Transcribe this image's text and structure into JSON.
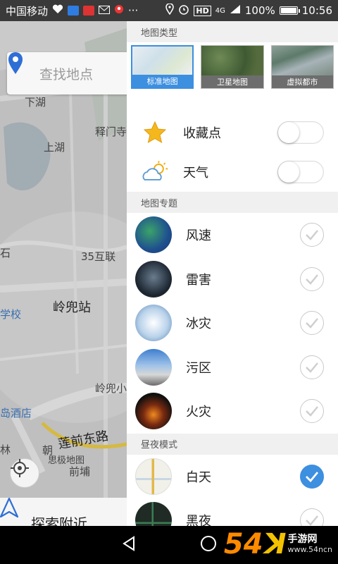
{
  "status_bar": {
    "carrier": "中国移动",
    "network": "4G",
    "battery": "100%",
    "time": "10:56"
  },
  "map": {
    "search_placeholder": "查找地点",
    "labels": [
      "下湖",
      "上湖",
      "释门寺",
      "35互联",
      "岭兜站",
      "岭兜小",
      "学校",
      "岛酒店",
      "林",
      "莲前东路",
      "思极地图",
      "前埔",
      "朝",
      "石"
    ],
    "nearby_label": "探索附近"
  },
  "drawer": {
    "map_type": {
      "header": "地图类型",
      "options": [
        {
          "label": "标准地图",
          "selected": true
        },
        {
          "label": "卫星地图",
          "selected": false
        },
        {
          "label": "虚拟都市",
          "selected": false
        }
      ]
    },
    "toggles": [
      {
        "label": "收藏点",
        "icon": "star-icon",
        "on": false
      },
      {
        "label": "天气",
        "icon": "weather-icon",
        "on": false
      }
    ],
    "topics": {
      "header": "地图专题",
      "items": [
        {
          "label": "风速",
          "checked": false
        },
        {
          "label": "雷害",
          "checked": false
        },
        {
          "label": "冰灾",
          "checked": false
        },
        {
          "label": "污区",
          "checked": false
        },
        {
          "label": "火灾",
          "checked": false
        }
      ]
    },
    "day_night": {
      "header": "昼夜模式",
      "items": [
        {
          "label": "白天",
          "checked": true
        },
        {
          "label": "黑夜",
          "checked": false
        }
      ]
    }
  },
  "watermark": {
    "number": "54",
    "glyph": "ꓘ",
    "title": "手游网",
    "domain": "www.54ncn"
  },
  "colors": {
    "accent": "#3d8fe0",
    "watermark_orange": "#ff8a00"
  }
}
